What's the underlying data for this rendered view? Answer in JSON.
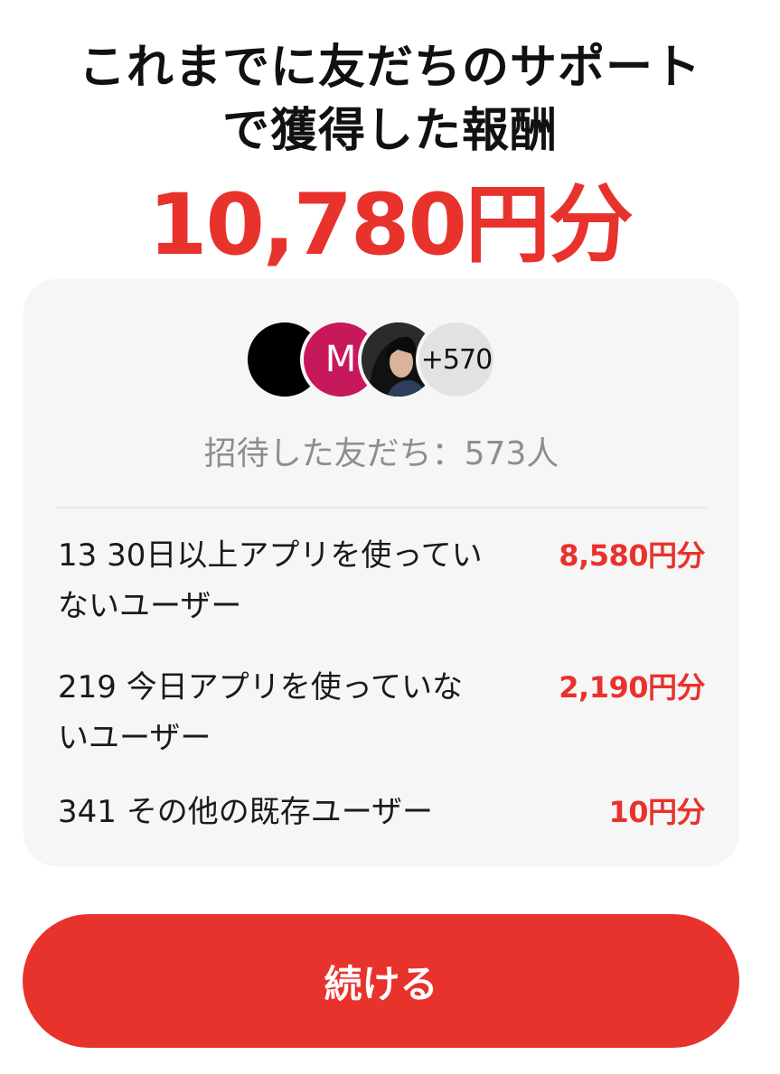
{
  "header": {
    "title_line1": "これまでに友だちのサポート",
    "title_line2": "で獲得した報酬",
    "total_reward": "10,780円分"
  },
  "card": {
    "avatars": {
      "avatar2_initial": "M",
      "more_count": "+570"
    },
    "invited_text": "招待した友だち：573人",
    "rows": [
      {
        "label": "13 30日以上アプリを使っていないユーザー",
        "value": "8,580円分"
      },
      {
        "label": "219 今日アプリを使っていないユーザー",
        "value": "2,190円分"
      },
      {
        "label": "341 その他の既存ユーザー",
        "value": "10円分"
      }
    ]
  },
  "actions": {
    "continue_label": "続ける"
  },
  "colors": {
    "accent": "#e8322c",
    "card_bg": "#f6f6f6",
    "muted_text": "#8e8e8e"
  }
}
